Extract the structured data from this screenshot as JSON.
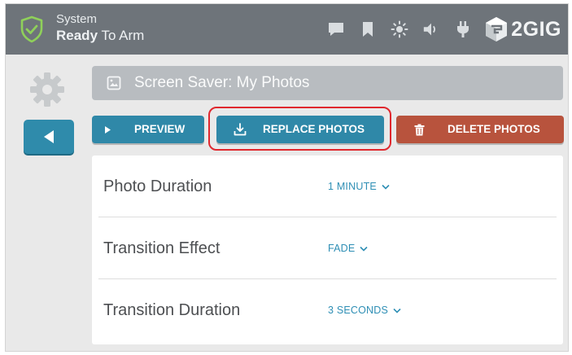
{
  "status": {
    "line1": "System",
    "line2_bold": "Ready",
    "line2_rest": " To Arm"
  },
  "topbar_icons": [
    "chat-icon",
    "bookmark-icon",
    "brightness-icon",
    "volume-icon",
    "power-plug-icon"
  ],
  "brand": {
    "name": "2GIG"
  },
  "header": {
    "title": "Screen Saver: My Photos"
  },
  "actions": {
    "preview_label": "PREVIEW",
    "replace_label": "REPLACE PHOTOS",
    "delete_label": "DELETE PHOTOS"
  },
  "settings": [
    {
      "label": "Photo Duration",
      "value": "1 MINUTE"
    },
    {
      "label": "Transition Effect",
      "value": "FADE"
    },
    {
      "label": "Transition Duration",
      "value": "3 SECONDS"
    }
  ],
  "colors": {
    "topbar": "#6e747a",
    "accent_blue": "#2f88a8",
    "delete_red": "#b8533d",
    "highlight": "#e0282e",
    "shield_green": "#7cc04a"
  }
}
